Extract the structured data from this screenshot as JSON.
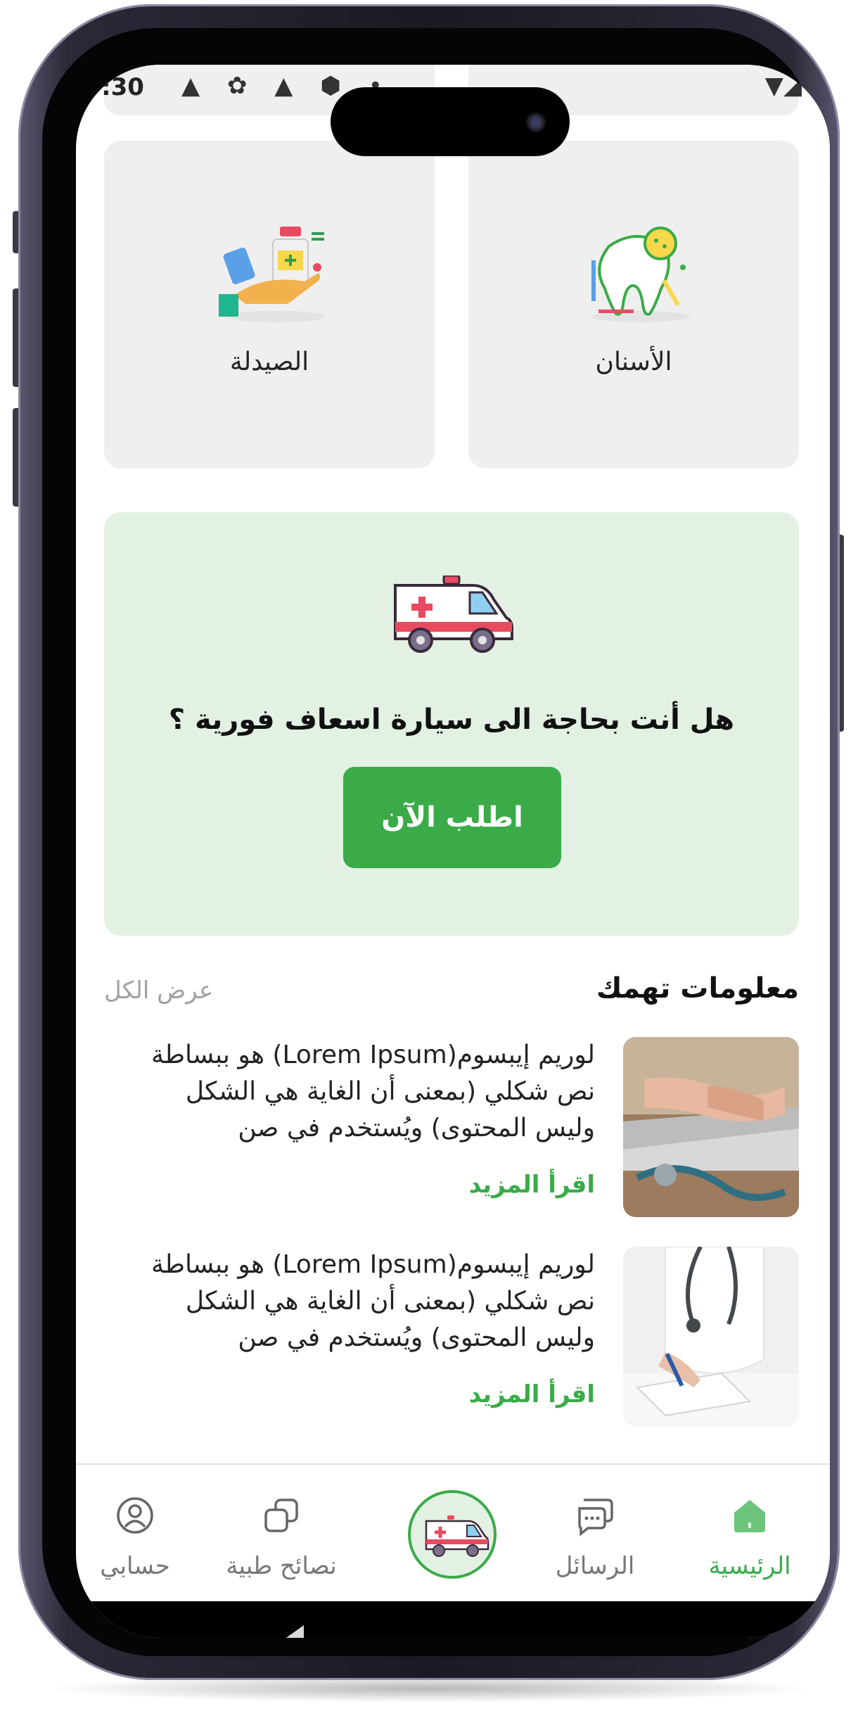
{
  "status_bar": {
    "time": ":30",
    "icons": "▲ ✿ ▲ ⬢ •",
    "right_icons": "▼◢"
  },
  "categories": [
    {
      "label": "الأسنان",
      "icon": "tooth-icon"
    },
    {
      "label": "الصيدلة",
      "icon": "pharmacy-icon"
    }
  ],
  "ambulance": {
    "question": "هل أنت بحاجة الى سيارة اسعاف فورية ؟",
    "button_label": "اطلب الآن",
    "icon": "ambulance-icon"
  },
  "info": {
    "title": "معلومات تهمك",
    "view_all": "عرض الكل",
    "articles": [
      {
        "text": "لوريم إيبسوم(Lorem Ipsum) هو ببساطة نص شكلي (بمعنى أن الغاية هي الشكل وليس المحتوى) ويُستخدم في صن",
        "read_more": "اقرأ المزيد",
        "image": "laptop-stethoscope-photo"
      },
      {
        "text": "لوريم إيبسوم(Lorem Ipsum) هو ببساطة نص شكلي (بمعنى أن الغاية هي الشكل وليس المحتوى) ويُستخدم في صن",
        "read_more": "اقرأ المزيد",
        "image": "doctor-writing-photo"
      }
    ]
  },
  "bottom_nav": {
    "home": "الرئيسية",
    "messages": "الرسائل",
    "tips": "نصائح طبية",
    "account": "حسابي",
    "center_icon": "ambulance-icon"
  },
  "colors": {
    "accent": "#3aab48",
    "ambulance_card_bg": "#e2f1e3",
    "category_card_bg": "#efefef"
  }
}
